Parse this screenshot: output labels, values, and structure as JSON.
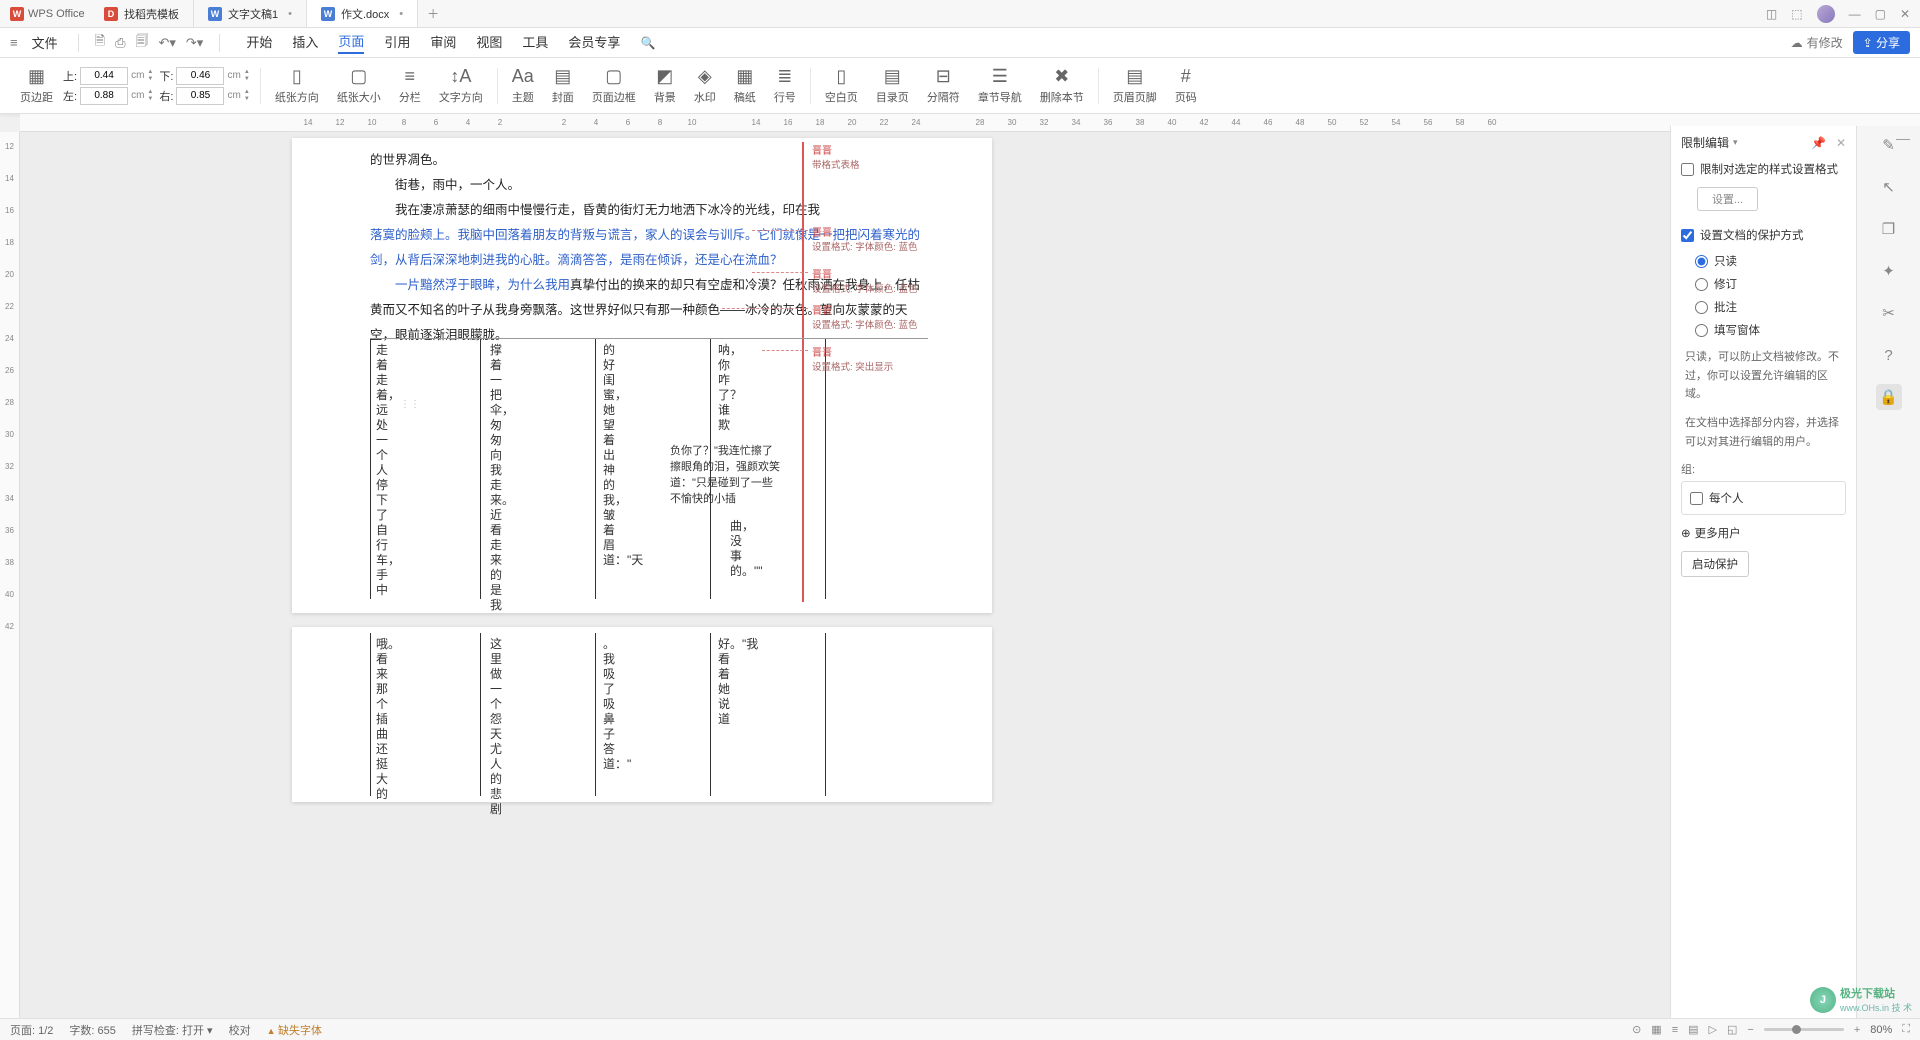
{
  "app": {
    "name": "WPS Office"
  },
  "tabs": [
    {
      "label": "找稻壳模板",
      "iconColor": "red"
    },
    {
      "label": "文字文稿1",
      "iconColor": "blue"
    },
    {
      "label": "作文.docx",
      "iconColor": "blue",
      "active": true
    }
  ],
  "menu": {
    "file": "文件",
    "items": [
      "开始",
      "插入",
      "页面",
      "引用",
      "审阅",
      "视图",
      "工具",
      "会员专享"
    ],
    "activeIndex": 2,
    "pending": "有修改",
    "share": "分享"
  },
  "ribbon": {
    "margin": {
      "label": "页边距",
      "top": "0.44",
      "bottom": "0.46",
      "left": "0.88",
      "right": "0.85",
      "unit": "cm",
      "marks": {
        "top": "上:",
        "bottom": "下:",
        "left": "左:",
        "right": "右:"
      }
    },
    "items": [
      {
        "label": "纸张方向",
        "drop": true
      },
      {
        "label": "纸张大小",
        "drop": true
      },
      {
        "label": "分栏",
        "drop": true
      },
      {
        "label": "文字方向",
        "drop": true
      },
      "sep",
      {
        "label": "主题",
        "drop": true
      },
      {
        "label": "封面",
        "drop": true
      },
      {
        "label": "页面边框"
      },
      {
        "label": "背景",
        "drop": true
      },
      {
        "label": "水印",
        "drop": true
      },
      {
        "label": "稿纸"
      },
      {
        "label": "行号",
        "drop": true
      },
      "sep",
      {
        "label": "空白页",
        "drop": true
      },
      {
        "label": "目录页",
        "drop": true
      },
      {
        "label": "分隔符",
        "drop": true
      },
      {
        "label": "章节导航"
      },
      {
        "label": "删除本节"
      },
      "sep",
      {
        "label": "页眉页脚"
      },
      {
        "label": "页码",
        "drop": true
      }
    ]
  },
  "rulerH": [
    "14",
    "12",
    "10",
    "8",
    "6",
    "4",
    "2",
    "",
    "2",
    "4",
    "6",
    "8",
    "10",
    "",
    "14",
    "16",
    "18",
    "20",
    "22",
    "24",
    "",
    "28",
    "30",
    "32",
    "34",
    "36",
    "38",
    "40",
    "42",
    "44",
    "46",
    "48",
    "50",
    "52",
    "54",
    "56",
    "58",
    "60"
  ],
  "rulerV": [
    "12",
    "14",
    "16",
    "18",
    "20",
    "22",
    "24",
    "26",
    "28",
    "30",
    "32",
    "34",
    "36",
    "38",
    "40",
    "42"
  ],
  "document": {
    "p1": "的世界凋色。",
    "p2": "街巷，雨中，一个人。",
    "p3a": "我在凄凉萧瑟的细雨中慢慢行走，昏黄的街灯无力地洒下冰冷的光线，印在我",
    "p3b": "落寞的脸颊上。我脑中回落着朋友的背叛与谎言，家人的误会与训斥。它们就像是一把把闪着寒光的剑，从背后深深地刺进我的心脏。滴滴答答，是雨在倾诉，还是心在流血？",
    "p4a": "一片黯然浮于眼眸，为什么我用",
    "p4b": "真挚付出的换来的却只有空虚和冷漠？任秋雨洒在我身上，任枯黄而又不知名的叶子从我身旁飘落。这世界好似只有那一种颜色——冰冷的灰色。望向灰蒙蒙的天空，眼前逐渐泪眼朦胧。",
    "c1": "走着走着，远处一个人停下了自行车，手中",
    "c2": "撑着一把伞，匆匆向我走来。近看走来的是我",
    "c3": "的好闺蜜，她望着出神的我，皱着眉道：\"天",
    "c4": "呐，你咋了？谁欺",
    "c4b": "负你了？\"我连忙擦了擦眼角的泪，强颜欢笑道：\"只是碰到了一些不愉快的小插",
    "c4c": "曲，没事的。\"\"",
    "p2_c1": "哦。看来那个插曲还挺大的",
    "p2_c2": "这里做一个怨天尤人的悲剧",
    "p2_c3": "。我吸了吸鼻子答道：\"",
    "p2_c4": "好。\"我看着她说道",
    "revisions": {
      "r0": {
        "author": "晋晋",
        "desc": "带格式表格"
      },
      "r1": {
        "author": "晋晋",
        "desc": "设置格式: 字体颜色: 蓝色"
      },
      "r2": {
        "author": "晋晋",
        "desc": "设置格式: 字体颜色: 蓝色"
      },
      "r3": {
        "author": "晋晋",
        "desc": "设置格式: 字体颜色: 蓝色"
      },
      "r4": {
        "author": "晋晋",
        "desc": "设置格式: 突出显示"
      }
    }
  },
  "sidePanel": {
    "title": "限制编辑",
    "styleLock": "限制对选定的样式设置格式",
    "settings": "设置...",
    "protect": "设置文档的保护方式",
    "modes": {
      "readonly": "只读",
      "revision": "修订",
      "comment": "批注",
      "form": "填写窗体"
    },
    "hint1": "只读，可以防止文档被修改。不过，你可以设置允许编辑的区域。",
    "hint2": "在文档中选择部分内容，并选择可以对其进行编辑的用户。",
    "groupLabel": "组:",
    "everyone": "每个人",
    "moreUsers": "更多用户",
    "start": "启动保护"
  },
  "status": {
    "page": "页面: 1/2",
    "words": "字数: 655",
    "spell": "拼写检查: 打开",
    "proof": "校对",
    "missingFont": "缺失字体",
    "zoom": "80%"
  },
  "watermark": {
    "text": "极光下载站",
    "sub": "www.OHs.in 技 术"
  }
}
